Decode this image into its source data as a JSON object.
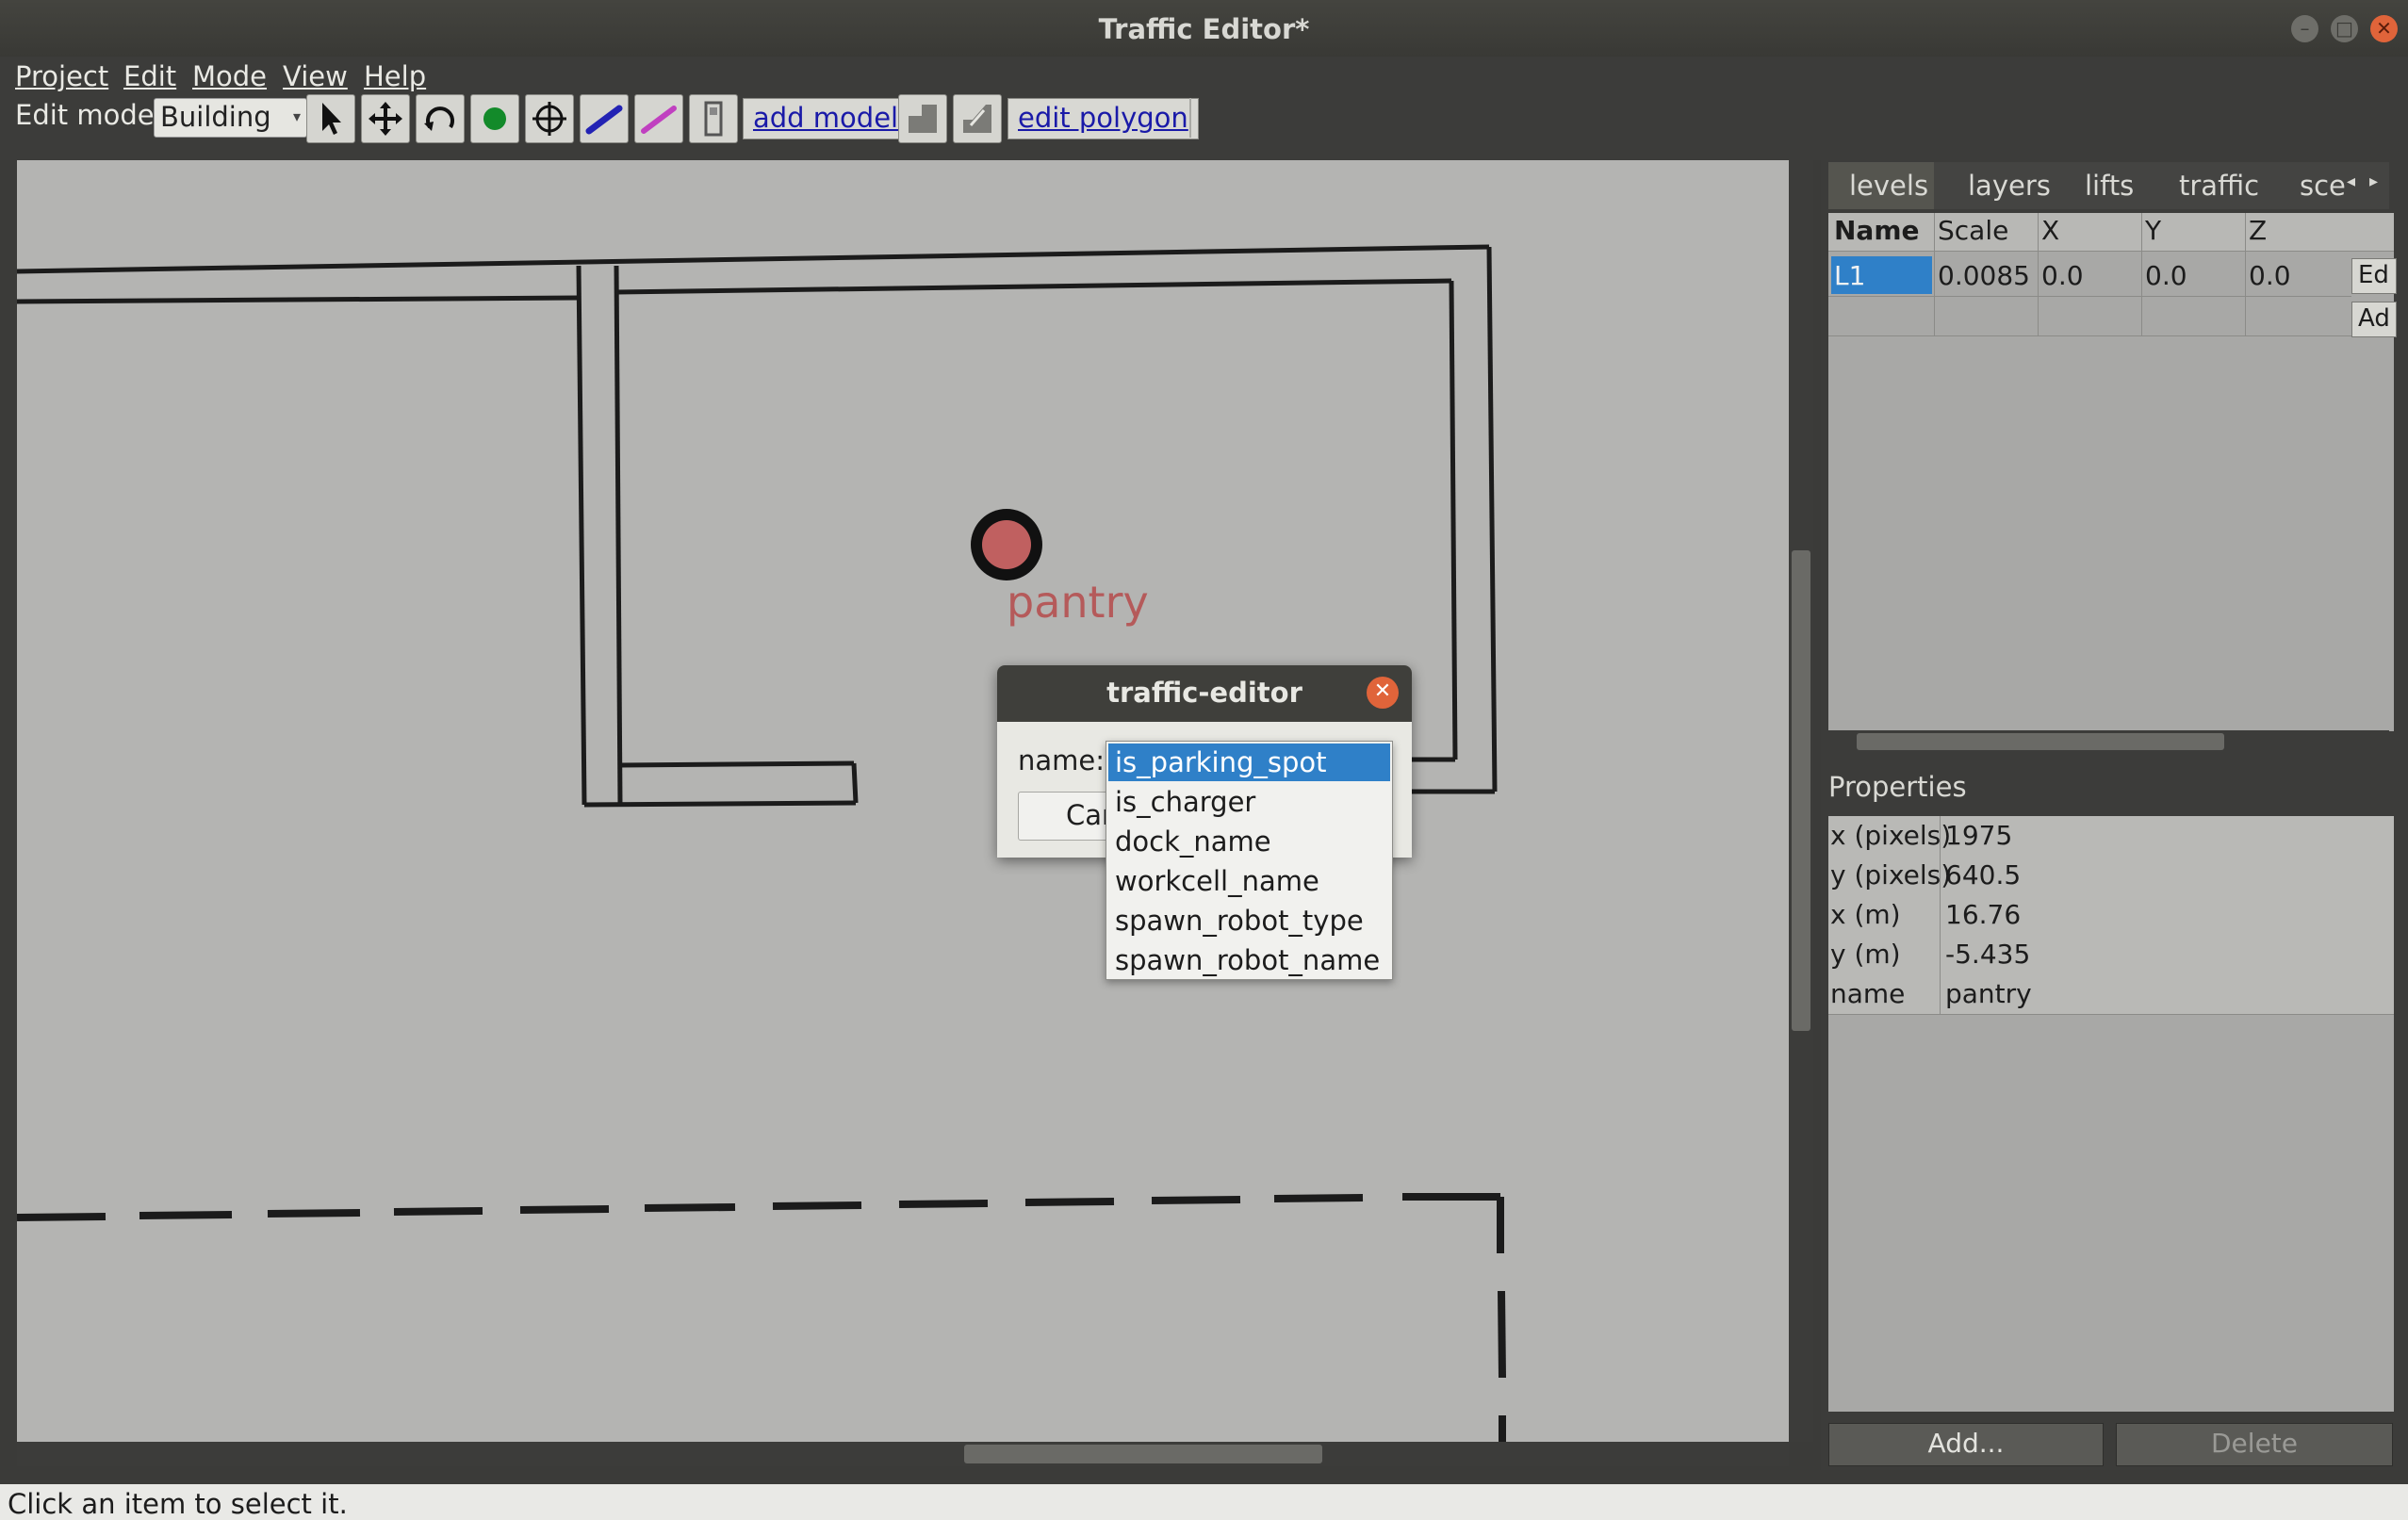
{
  "window": {
    "title": "Traffic Editor*"
  },
  "menu": [
    "Project",
    "Edit",
    "Mode",
    "View",
    "Help"
  ],
  "toolbar": {
    "edit_mode_label": "Edit mode:",
    "edit_mode_value": "Building",
    "add_model": "add model",
    "edit_polygon": "edit polygon"
  },
  "canvas": {
    "vertex_label": "pantry"
  },
  "panel": {
    "tabs": [
      "levels",
      "layers",
      "lifts",
      "traffic",
      "sce"
    ],
    "columns": [
      "Name",
      "Scale",
      "X",
      "Y",
      "Z"
    ],
    "rows": [
      {
        "name": "L1",
        "scale": "0.0085",
        "x": "0.0",
        "y": "0.0",
        "z": "0.0"
      }
    ],
    "row_buttons": [
      "Ed",
      "Ad"
    ],
    "properties_title": "Properties",
    "properties": [
      {
        "key": "x (pixels)",
        "value": "1975"
      },
      {
        "key": "y (pixels)",
        "value": "640.5"
      },
      {
        "key": "x (m)",
        "value": "16.76"
      },
      {
        "key": "y (m)",
        "value": "-5.435"
      },
      {
        "key": "name",
        "value": "pantry"
      }
    ],
    "add_button": "Add...",
    "delete_button": "Delete"
  },
  "dialog": {
    "title": "traffic-editor",
    "field_label": "name:",
    "cancel_button": "Car",
    "options": [
      "is_parking_spot",
      "is_charger",
      "dock_name",
      "workcell_name",
      "spawn_robot_type",
      "spawn_robot_name"
    ],
    "selected": "is_parking_spot"
  },
  "status": {
    "text": "Click an item to select it."
  },
  "colors": {
    "selection": "#2f80c8",
    "vertex": "#c06060",
    "close_button": "#e0643a",
    "link": "#1a1aa8"
  }
}
